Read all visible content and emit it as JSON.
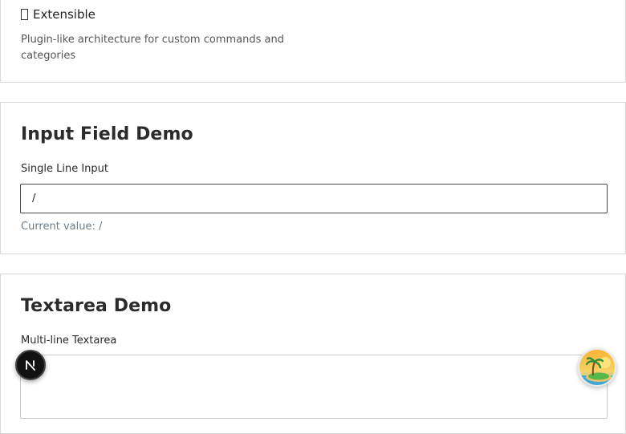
{
  "features": {
    "extensible_title": "Extensible",
    "extensible_desc": "Plugin-like architecture for custom commands and categories"
  },
  "input_demo": {
    "title": "Input Field Demo",
    "label": "Single Line Input",
    "value": "/",
    "current_value_prefix": "Current value: ",
    "current_value": "/"
  },
  "textarea_demo": {
    "title": "Textarea Demo",
    "label": "Multi-line Textarea",
    "value": ""
  },
  "icons": {
    "next_badge": "next-logo-icon",
    "assistant": "island-icon"
  }
}
